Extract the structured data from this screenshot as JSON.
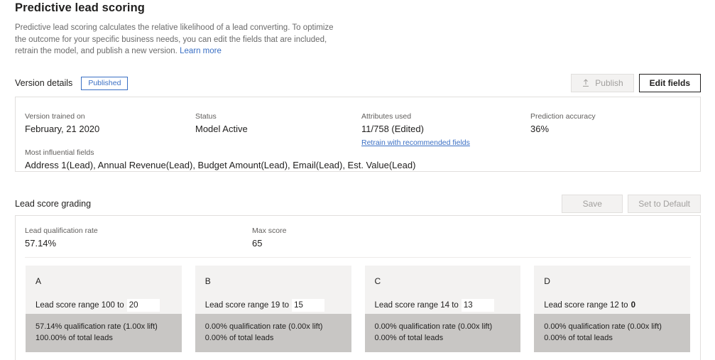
{
  "page": {
    "title": "Predictive lead scoring",
    "description": "Predictive lead scoring calculates the relative likelihood of a lead converting. To optimize the outcome for your specific business needs, you can edit the fields that are included, retrain the model, and publish a new version.",
    "learn_more_label": "Learn more"
  },
  "version_section": {
    "title": "Version details",
    "badge_label": "Published",
    "publish_button_label": "Publish",
    "publish_icon": "upload-icon",
    "publish_disabled": true,
    "edit_fields_button_label": "Edit fields",
    "fields": {
      "trained_on_label": "Version trained on",
      "trained_on_value": "February, 21 2020",
      "status_label": "Status",
      "status_value": "Model Active",
      "attributes_label": "Attributes used",
      "attributes_value": "11/758 (Edited)",
      "retrain_link_label": "Retrain with recommended fields",
      "accuracy_label": "Prediction accuracy",
      "accuracy_value": "36%",
      "influential_label": "Most influential fields",
      "influential_value": "Address 1(Lead), Annual Revenue(Lead), Budget Amount(Lead), Email(Lead), Est. Value(Lead)"
    }
  },
  "grading_section": {
    "title": "Lead score grading",
    "save_button_label": "Save",
    "save_disabled": true,
    "set_default_button_label": "Set to Default",
    "set_default_disabled": true,
    "qualification_rate_label": "Lead qualification rate",
    "qualification_rate_value": "57.14%",
    "max_score_label": "Max score",
    "max_score_value": "65",
    "range_prefix": "Lead score range",
    "range_joiner": "to",
    "grades": [
      {
        "letter": "A",
        "range_from": "100",
        "range_to": "20",
        "editable": true,
        "qualification_line": "57.14% qualification rate (1.00x lift)",
        "total_leads_line": "100.00% of total leads"
      },
      {
        "letter": "B",
        "range_from": "19",
        "range_to": "15",
        "editable": true,
        "qualification_line": "0.00% qualification rate (0.00x lift)",
        "total_leads_line": "0.00% of total leads"
      },
      {
        "letter": "C",
        "range_from": "14",
        "range_to": "13",
        "editable": true,
        "qualification_line": "0.00% qualification rate (0.00x lift)",
        "total_leads_line": "0.00% of total leads"
      },
      {
        "letter": "D",
        "range_from": "12",
        "range_to": "0",
        "editable": false,
        "qualification_line": "0.00% qualification rate (0.00x lift)",
        "total_leads_line": "0.00% of total leads"
      }
    ]
  },
  "colors": {
    "accent_link": "#3a6fc4",
    "card_top_bg": "#f3f2f1",
    "card_bottom_bg": "#c8c6c4",
    "panel_border": "#e1dfdd"
  }
}
